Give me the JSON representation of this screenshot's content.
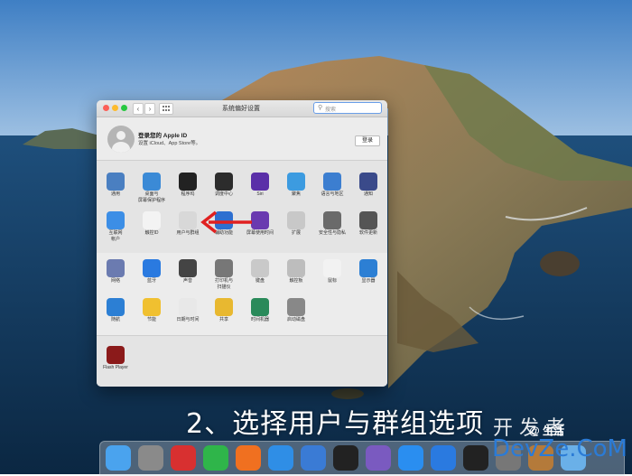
{
  "window": {
    "title": "系统偏好设置",
    "nav_back": "‹",
    "nav_forward": "›",
    "search_placeholder": "搜索"
  },
  "apple_id": {
    "title": "登录您的 Apple ID",
    "subtitle": "设置 iCloud、App Store等。",
    "login_button": "登录"
  },
  "panes": [
    {
      "label": "通用",
      "icon": "general-icon",
      "color": "#4a7fc1"
    },
    {
      "label": "桌面与\n屏幕保护程序",
      "icon": "desktop-icon",
      "color": "#3b8ad6"
    },
    {
      "label": "程序坞",
      "icon": "dock-icon",
      "color": "#222"
    },
    {
      "label": "调度中心",
      "icon": "mission-control-icon",
      "color": "#2c2c2c"
    },
    {
      "label": "Siri",
      "icon": "siri-icon",
      "color": "#5a2fa8"
    },
    {
      "label": "聚焦",
      "icon": "spotlight-icon",
      "color": "#3c9be0"
    },
    {
      "label": "语言与地区",
      "icon": "language-icon",
      "color": "#3c7ed0"
    },
    {
      "label": "通知",
      "icon": "notifications-icon",
      "color": "#3a4a8a"
    },
    {
      "label": "互联网\n帐户",
      "icon": "internet-accounts-icon",
      "color": "#3c8ee6"
    },
    {
      "label": "触控ID",
      "icon": "touch-id-icon",
      "color": "#f3f3f3"
    },
    {
      "label": "用户与群组",
      "icon": "users-groups-icon",
      "color": "#d8d8d8"
    },
    {
      "label": "辅助功能",
      "icon": "accessibility-icon",
      "color": "#2d6fd0"
    },
    {
      "label": "屏幕使用时间",
      "icon": "screen-time-icon",
      "color": "#6a3ab0"
    },
    {
      "label": "扩展",
      "icon": "extensions-icon",
      "color": "#c8c8c8"
    },
    {
      "label": "安全性与隐私",
      "icon": "security-icon",
      "color": "#6a6a6a"
    },
    {
      "label": "软件更新",
      "icon": "software-update-icon",
      "color": "#555"
    },
    {
      "label": "网络",
      "icon": "network-icon",
      "color": "#6b7bb0"
    },
    {
      "label": "蓝牙",
      "icon": "bluetooth-icon",
      "color": "#2a7ae0"
    },
    {
      "label": "声音",
      "icon": "sound-icon",
      "color": "#444"
    },
    {
      "label": "打印机与\n扫描仪",
      "icon": "printers-icon",
      "color": "#777"
    },
    {
      "label": "键盘",
      "icon": "keyboard-icon",
      "color": "#c9c9c9"
    },
    {
      "label": "触控板",
      "icon": "trackpad-icon",
      "color": "#bdbdbd"
    },
    {
      "label": "鼠标",
      "icon": "mouse-icon",
      "color": "#f2f2f2"
    },
    {
      "label": "显示器",
      "icon": "displays-icon",
      "color": "#2c7fd4"
    },
    {
      "label": "随航",
      "icon": "sidecar-icon",
      "color": "#2c7fd4"
    },
    {
      "label": "节能",
      "icon": "energy-saver-icon",
      "color": "#f0c030"
    },
    {
      "label": "日期与时间",
      "icon": "date-time-icon",
      "color": "#e8e8e8"
    },
    {
      "label": "共享",
      "icon": "sharing-icon",
      "color": "#e8b830"
    },
    {
      "label": "时间机器",
      "icon": "time-machine-icon",
      "color": "#2a8a5a"
    },
    {
      "label": "启动磁盘",
      "icon": "startup-disk-icon",
      "color": "#888"
    },
    {
      "label": "Flash Player",
      "icon": "flash-player-icon",
      "color": "#8b1a1a"
    }
  ],
  "caption": "2、选择用户与群组选项",
  "watermark": {
    "cn": "开 发 者",
    "small": "@ 生活",
    "url": "DevZe.CoM"
  },
  "dock": [
    {
      "icon": "finder-icon",
      "color": "#4aa3ee"
    },
    {
      "icon": "launchpad-icon",
      "color": "#8a8a8a"
    },
    {
      "icon": "app-red-icon",
      "color": "#d83030"
    },
    {
      "icon": "wechat-icon",
      "color": "#2fb54a"
    },
    {
      "icon": "firefox-icon",
      "color": "#f07020"
    },
    {
      "icon": "safari-icon",
      "color": "#2f8ee6"
    },
    {
      "icon": "xcode-icon",
      "color": "#3a7bd5"
    },
    {
      "icon": "app-black-icon",
      "color": "#222"
    },
    {
      "icon": "app-colorful-icon",
      "color": "#7a5ac0"
    },
    {
      "icon": "app-store-icon",
      "color": "#2a8ef0"
    },
    {
      "icon": "upload-icon",
      "color": "#2a7ae0"
    },
    {
      "icon": "terminal-icon",
      "color": "#222"
    },
    {
      "icon": "system-preferences-icon",
      "color": "#777"
    },
    {
      "icon": "folder-icon",
      "color": "#b47a3a"
    },
    {
      "icon": "downloads-icon",
      "color": "#6ab0e8"
    }
  ]
}
